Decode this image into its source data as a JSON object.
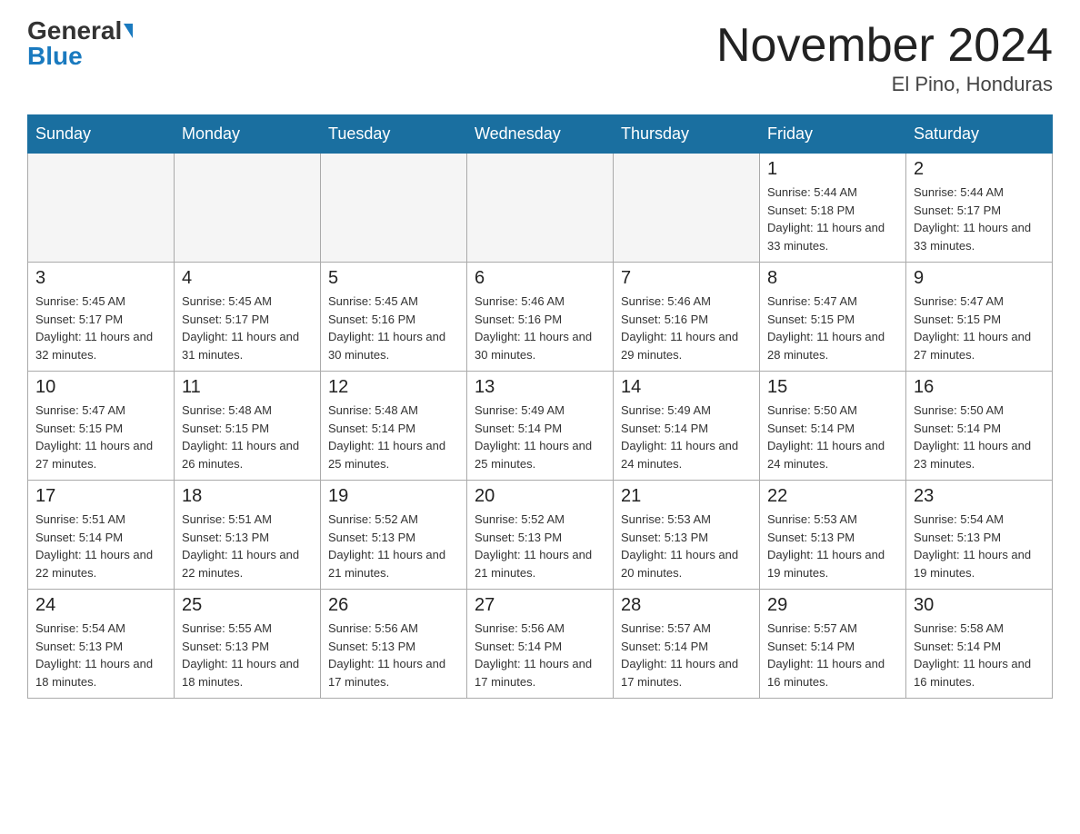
{
  "logo": {
    "general": "General",
    "blue": "Blue"
  },
  "title": {
    "month": "November 2024",
    "location": "El Pino, Honduras"
  },
  "header_days": [
    "Sunday",
    "Monday",
    "Tuesday",
    "Wednesday",
    "Thursday",
    "Friday",
    "Saturday"
  ],
  "weeks": [
    [
      {
        "day": "",
        "sunrise": "",
        "sunset": "",
        "daylight": "",
        "empty": true
      },
      {
        "day": "",
        "sunrise": "",
        "sunset": "",
        "daylight": "",
        "empty": true
      },
      {
        "day": "",
        "sunrise": "",
        "sunset": "",
        "daylight": "",
        "empty": true
      },
      {
        "day": "",
        "sunrise": "",
        "sunset": "",
        "daylight": "",
        "empty": true
      },
      {
        "day": "",
        "sunrise": "",
        "sunset": "",
        "daylight": "",
        "empty": true
      },
      {
        "day": "1",
        "sunrise": "Sunrise: 5:44 AM",
        "sunset": "Sunset: 5:18 PM",
        "daylight": "Daylight: 11 hours and 33 minutes.",
        "empty": false
      },
      {
        "day": "2",
        "sunrise": "Sunrise: 5:44 AM",
        "sunset": "Sunset: 5:17 PM",
        "daylight": "Daylight: 11 hours and 33 minutes.",
        "empty": false
      }
    ],
    [
      {
        "day": "3",
        "sunrise": "Sunrise: 5:45 AM",
        "sunset": "Sunset: 5:17 PM",
        "daylight": "Daylight: 11 hours and 32 minutes.",
        "empty": false
      },
      {
        "day": "4",
        "sunrise": "Sunrise: 5:45 AM",
        "sunset": "Sunset: 5:17 PM",
        "daylight": "Daylight: 11 hours and 31 minutes.",
        "empty": false
      },
      {
        "day": "5",
        "sunrise": "Sunrise: 5:45 AM",
        "sunset": "Sunset: 5:16 PM",
        "daylight": "Daylight: 11 hours and 30 minutes.",
        "empty": false
      },
      {
        "day": "6",
        "sunrise": "Sunrise: 5:46 AM",
        "sunset": "Sunset: 5:16 PM",
        "daylight": "Daylight: 11 hours and 30 minutes.",
        "empty": false
      },
      {
        "day": "7",
        "sunrise": "Sunrise: 5:46 AM",
        "sunset": "Sunset: 5:16 PM",
        "daylight": "Daylight: 11 hours and 29 minutes.",
        "empty": false
      },
      {
        "day": "8",
        "sunrise": "Sunrise: 5:47 AM",
        "sunset": "Sunset: 5:15 PM",
        "daylight": "Daylight: 11 hours and 28 minutes.",
        "empty": false
      },
      {
        "day": "9",
        "sunrise": "Sunrise: 5:47 AM",
        "sunset": "Sunset: 5:15 PM",
        "daylight": "Daylight: 11 hours and 27 minutes.",
        "empty": false
      }
    ],
    [
      {
        "day": "10",
        "sunrise": "Sunrise: 5:47 AM",
        "sunset": "Sunset: 5:15 PM",
        "daylight": "Daylight: 11 hours and 27 minutes.",
        "empty": false
      },
      {
        "day": "11",
        "sunrise": "Sunrise: 5:48 AM",
        "sunset": "Sunset: 5:15 PM",
        "daylight": "Daylight: 11 hours and 26 minutes.",
        "empty": false
      },
      {
        "day": "12",
        "sunrise": "Sunrise: 5:48 AM",
        "sunset": "Sunset: 5:14 PM",
        "daylight": "Daylight: 11 hours and 25 minutes.",
        "empty": false
      },
      {
        "day": "13",
        "sunrise": "Sunrise: 5:49 AM",
        "sunset": "Sunset: 5:14 PM",
        "daylight": "Daylight: 11 hours and 25 minutes.",
        "empty": false
      },
      {
        "day": "14",
        "sunrise": "Sunrise: 5:49 AM",
        "sunset": "Sunset: 5:14 PM",
        "daylight": "Daylight: 11 hours and 24 minutes.",
        "empty": false
      },
      {
        "day": "15",
        "sunrise": "Sunrise: 5:50 AM",
        "sunset": "Sunset: 5:14 PM",
        "daylight": "Daylight: 11 hours and 24 minutes.",
        "empty": false
      },
      {
        "day": "16",
        "sunrise": "Sunrise: 5:50 AM",
        "sunset": "Sunset: 5:14 PM",
        "daylight": "Daylight: 11 hours and 23 minutes.",
        "empty": false
      }
    ],
    [
      {
        "day": "17",
        "sunrise": "Sunrise: 5:51 AM",
        "sunset": "Sunset: 5:14 PM",
        "daylight": "Daylight: 11 hours and 22 minutes.",
        "empty": false
      },
      {
        "day": "18",
        "sunrise": "Sunrise: 5:51 AM",
        "sunset": "Sunset: 5:13 PM",
        "daylight": "Daylight: 11 hours and 22 minutes.",
        "empty": false
      },
      {
        "day": "19",
        "sunrise": "Sunrise: 5:52 AM",
        "sunset": "Sunset: 5:13 PM",
        "daylight": "Daylight: 11 hours and 21 minutes.",
        "empty": false
      },
      {
        "day": "20",
        "sunrise": "Sunrise: 5:52 AM",
        "sunset": "Sunset: 5:13 PM",
        "daylight": "Daylight: 11 hours and 21 minutes.",
        "empty": false
      },
      {
        "day": "21",
        "sunrise": "Sunrise: 5:53 AM",
        "sunset": "Sunset: 5:13 PM",
        "daylight": "Daylight: 11 hours and 20 minutes.",
        "empty": false
      },
      {
        "day": "22",
        "sunrise": "Sunrise: 5:53 AM",
        "sunset": "Sunset: 5:13 PM",
        "daylight": "Daylight: 11 hours and 19 minutes.",
        "empty": false
      },
      {
        "day": "23",
        "sunrise": "Sunrise: 5:54 AM",
        "sunset": "Sunset: 5:13 PM",
        "daylight": "Daylight: 11 hours and 19 minutes.",
        "empty": false
      }
    ],
    [
      {
        "day": "24",
        "sunrise": "Sunrise: 5:54 AM",
        "sunset": "Sunset: 5:13 PM",
        "daylight": "Daylight: 11 hours and 18 minutes.",
        "empty": false
      },
      {
        "day": "25",
        "sunrise": "Sunrise: 5:55 AM",
        "sunset": "Sunset: 5:13 PM",
        "daylight": "Daylight: 11 hours and 18 minutes.",
        "empty": false
      },
      {
        "day": "26",
        "sunrise": "Sunrise: 5:56 AM",
        "sunset": "Sunset: 5:13 PM",
        "daylight": "Daylight: 11 hours and 17 minutes.",
        "empty": false
      },
      {
        "day": "27",
        "sunrise": "Sunrise: 5:56 AM",
        "sunset": "Sunset: 5:14 PM",
        "daylight": "Daylight: 11 hours and 17 minutes.",
        "empty": false
      },
      {
        "day": "28",
        "sunrise": "Sunrise: 5:57 AM",
        "sunset": "Sunset: 5:14 PM",
        "daylight": "Daylight: 11 hours and 17 minutes.",
        "empty": false
      },
      {
        "day": "29",
        "sunrise": "Sunrise: 5:57 AM",
        "sunset": "Sunset: 5:14 PM",
        "daylight": "Daylight: 11 hours and 16 minutes.",
        "empty": false
      },
      {
        "day": "30",
        "sunrise": "Sunrise: 5:58 AM",
        "sunset": "Sunset: 5:14 PM",
        "daylight": "Daylight: 11 hours and 16 minutes.",
        "empty": false
      }
    ]
  ]
}
